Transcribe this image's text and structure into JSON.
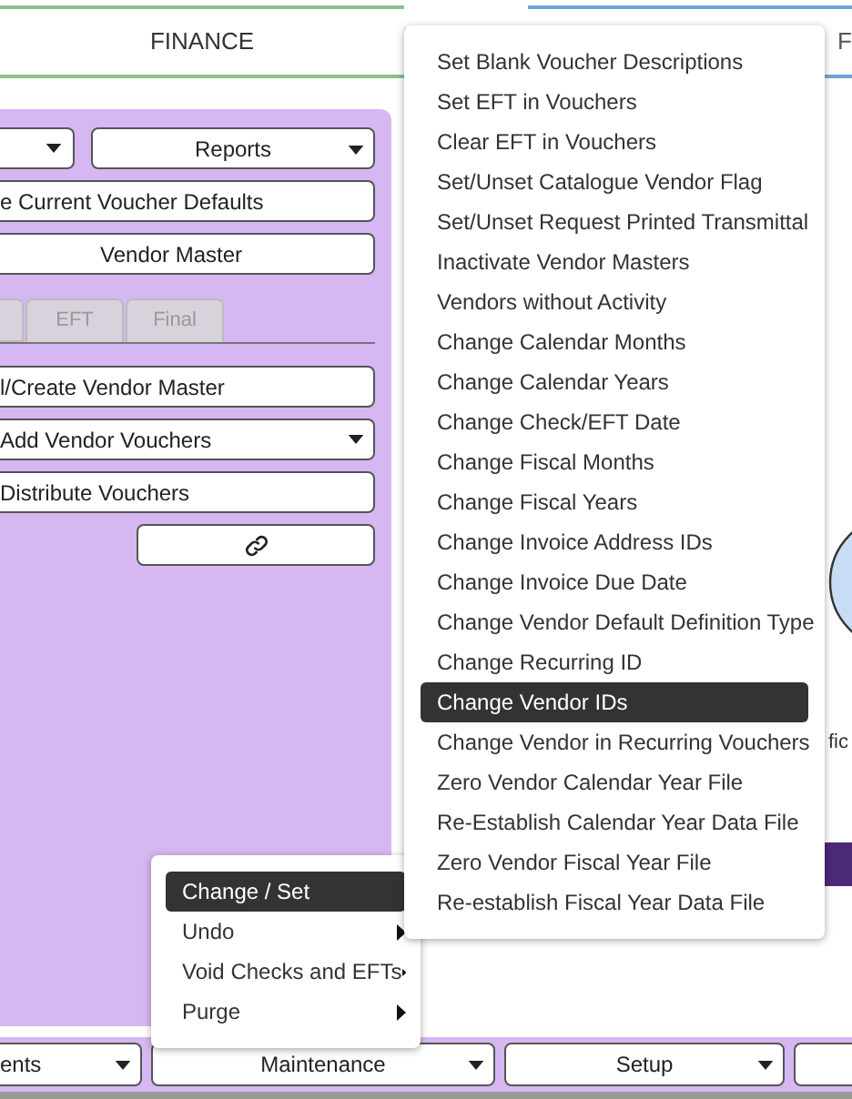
{
  "tabs": [
    {
      "label": "FINANCE",
      "selected": true
    },
    {
      "label": "F",
      "selected": false
    }
  ],
  "panel": {
    "reports_dropdown": {
      "label": "Reports"
    },
    "buttons": [
      {
        "label": "e Current Voucher Defaults"
      },
      {
        "label": "Vendor Master"
      }
    ],
    "subtabs": [
      {
        "label": "EFT",
        "disabled": true
      },
      {
        "label": "Final",
        "disabled": true
      }
    ],
    "actions": [
      {
        "kind": "button",
        "label": "l/Create Vendor Master"
      },
      {
        "kind": "dropdown",
        "label": "Add Vendor Vouchers"
      },
      {
        "kind": "button",
        "label": "Distribute Vouchers"
      },
      {
        "kind": "link"
      }
    ]
  },
  "side_text": "fic",
  "bottom_bar": [
    {
      "kind": "dropdown",
      "label": "ents"
    },
    {
      "kind": "dropdown",
      "label": "Maintenance"
    },
    {
      "kind": "dropdown",
      "label": "Setup"
    },
    {
      "kind": "plain"
    }
  ],
  "maintenance_menu": [
    {
      "label": "Change / Set",
      "selected": true,
      "submenu": false
    },
    {
      "label": "Undo",
      "selected": false,
      "submenu": true
    },
    {
      "label": "Void Checks and EFTs",
      "selected": false,
      "submenu": true
    },
    {
      "label": "Purge",
      "selected": false,
      "submenu": true
    }
  ],
  "change_set_menu": [
    {
      "label": "Set Blank Voucher Descriptions",
      "selected": false
    },
    {
      "label": "Set EFT in Vouchers",
      "selected": false
    },
    {
      "label": "Clear EFT in Vouchers",
      "selected": false
    },
    {
      "label": "Set/Unset Catalogue Vendor Flag",
      "selected": false
    },
    {
      "label": "Set/Unset Request Printed Transmittal",
      "selected": false
    },
    {
      "label": "Inactivate Vendor Masters",
      "selected": false
    },
    {
      "label": "Vendors without Activity",
      "selected": false
    },
    {
      "label": "Change Calendar Months",
      "selected": false
    },
    {
      "label": "Change Calendar Years",
      "selected": false
    },
    {
      "label": "Change Check/EFT Date",
      "selected": false
    },
    {
      "label": "Change Fiscal Months",
      "selected": false
    },
    {
      "label": "Change Fiscal Years",
      "selected": false
    },
    {
      "label": "Change Invoice Address IDs",
      "selected": false
    },
    {
      "label": "Change Invoice Due Date",
      "selected": false
    },
    {
      "label": "Change Vendor Default Definition Type",
      "selected": false
    },
    {
      "label": "Change Recurring ID",
      "selected": false
    },
    {
      "label": "Change Vendor IDs",
      "selected": true
    },
    {
      "label": "Change Vendor in Recurring Vouchers",
      "selected": false
    },
    {
      "label": "Zero Vendor Calendar Year File",
      "selected": false
    },
    {
      "label": "Re-Establish Calendar Year Data File",
      "selected": false
    },
    {
      "label": "Zero Vendor Fiscal Year File",
      "selected": false
    },
    {
      "label": "Re-establish Fiscal Year Data File",
      "selected": false
    }
  ]
}
